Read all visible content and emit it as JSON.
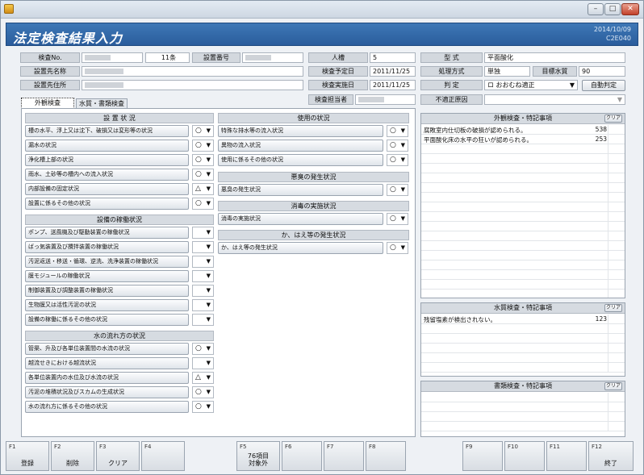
{
  "window": {
    "controls": [
      "–",
      "□",
      "✕"
    ]
  },
  "header": {
    "title": "法定検査結果入力",
    "date": "2014/10/09",
    "code": "C2E040"
  },
  "form": {
    "inspection_no_label": "検査No.",
    "inspection_count": "11条",
    "equipment_no_label": "設置番号",
    "installer_name_label": "設置先名称",
    "installer_address_label": "設置先住所",
    "persons_label": "人槽",
    "persons_value": "5",
    "scheduled_date_label": "検査予定日",
    "scheduled_date_value": "2011/11/25",
    "executed_date_label": "検査実施日",
    "executed_date_value": "2011/11/25",
    "inspector_label": "検査担当者",
    "model_label": "型 式",
    "model_value": "平面酸化",
    "method_label": "処理方式",
    "method_value": "単独",
    "target_quality_label": "目標水質",
    "target_quality_value": "90",
    "judgement_label": "判 定",
    "judgement_value": "ロ おおむね適正",
    "auto_judge_button": "自動判定",
    "improper_reason_label": "不適正原因"
  },
  "tabs": [
    {
      "label": "外観検査"
    },
    {
      "label": "水質・書類検査"
    }
  ],
  "sections": {
    "equipment": "設 置 状 況",
    "operation": "設備の稼働状況",
    "waterflow": "水の流れ方の状況",
    "usage": "使用の状況",
    "odor": "悪臭の発生状況",
    "disinfection": "消毒の実施状況",
    "insects": "か、はえ等の発生状況"
  },
  "left_items": [
    {
      "label": "槽の水平、浮上又は沈下、破損又は変形等の状況",
      "value": "○"
    },
    {
      "label": "漏水の状況",
      "value": "○"
    },
    {
      "label": "浄化槽上部の状況",
      "value": "○"
    },
    {
      "label": "雨水、土砂等の槽内への流入状況",
      "value": "○"
    },
    {
      "label": "内部設備の固定状況",
      "value": "△"
    },
    {
      "label": "設置に係るその他の状況",
      "value": "○"
    },
    {
      "label": "ポンプ、送風機及び駆動装置の稼働状況",
      "value": ""
    },
    {
      "label": "ばっ気装置及び攪拌装置の稼働状況",
      "value": ""
    },
    {
      "label": "汚泥返送・移送・循環、逆洗、洗浄装置の稼働状況",
      "value": ""
    },
    {
      "label": "膜モジュールの稼働状況",
      "value": ""
    },
    {
      "label": "制御装置及び調整装置の稼働状況",
      "value": ""
    },
    {
      "label": "生物膜又は活性汚泥の状況",
      "value": ""
    },
    {
      "label": "設備の稼働に係るその他の状況",
      "value": ""
    },
    {
      "label": "管渠、升及び各単位装置間の水流の状況",
      "value": "○"
    },
    {
      "label": "越流せきにおける越流状況",
      "value": ""
    },
    {
      "label": "各単位装置内の水位及び水流の状況",
      "value": "△"
    },
    {
      "label": "汚泥の堆積状況及びスカムの生成状況",
      "value": "○"
    },
    {
      "label": "水の流れ方に係るその他の状況",
      "value": "○"
    }
  ],
  "right_items": [
    {
      "label": "特殊な排水等の流入状況",
      "value": "○"
    },
    {
      "label": "異物の流入状況",
      "value": "○"
    },
    {
      "label": "使用に係るその他の状況",
      "value": "○"
    },
    {
      "label": "悪臭の発生状況",
      "value": "○"
    },
    {
      "label": "消毒の実施状況",
      "value": "○"
    },
    {
      "label": "か、はえ等の発生状況",
      "value": "○"
    }
  ],
  "visual_notes": {
    "title": "外観検査・特記事項",
    "clear": "クリア",
    "items": [
      {
        "text": "腐敗室内仕切板の破損が認められる。",
        "code": "538"
      },
      {
        "text": "平面酸化床の水平の狂いが認められる。",
        "code": "253"
      }
    ]
  },
  "water_notes": {
    "title": "水質検査・特記事項",
    "clear": "クリア",
    "items": [
      {
        "text": "残留塩素が検出されない。",
        "code": "123"
      }
    ]
  },
  "doc_notes": {
    "title": "書類検査・特記事項",
    "clear": "クリア"
  },
  "fkeys": [
    {
      "key": "F1",
      "label": "登録"
    },
    {
      "key": "F2",
      "label": "削除"
    },
    {
      "key": "F3",
      "label": "クリア"
    },
    {
      "key": "F4",
      "label": ""
    },
    {
      "key": "F5",
      "label": "76項目\n対象外"
    },
    {
      "key": "F6",
      "label": ""
    },
    {
      "key": "F7",
      "label": ""
    },
    {
      "key": "F8",
      "label": ""
    },
    {
      "key": "F9",
      "label": ""
    },
    {
      "key": "F10",
      "label": ""
    },
    {
      "key": "F11",
      "label": ""
    },
    {
      "key": "F12",
      "label": "終了"
    }
  ]
}
